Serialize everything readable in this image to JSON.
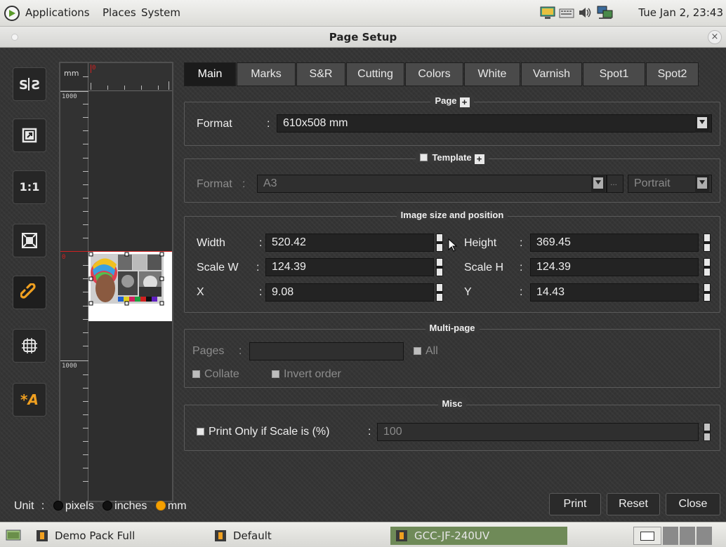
{
  "topbar": {
    "menus": [
      "Applications",
      "Places",
      "System"
    ],
    "clock": "Tue Jan  2, 23:43"
  },
  "window": {
    "title": "Page Setup",
    "close_glyph": "×"
  },
  "toolbar": [
    {
      "name": "split-view-button",
      "glyph": "S|S"
    },
    {
      "name": "fit-page-button",
      "glyph": "⧉"
    },
    {
      "name": "actual-size-button",
      "glyph": "1:1"
    },
    {
      "name": "fit-window-button",
      "glyph": "⊠"
    },
    {
      "name": "link-button",
      "glyph": "∞"
    },
    {
      "name": "center-button",
      "glyph": "⌗"
    },
    {
      "name": "auto-button",
      "glyph": "*A"
    }
  ],
  "preview": {
    "unit": "mm",
    "hruler_label": "0",
    "vruler_labels": [
      "1000",
      "0",
      "1000"
    ]
  },
  "tabs": [
    "Main",
    "Marks",
    "S&R",
    "Cutting",
    "Colors",
    "White",
    "Varnish",
    "Spot1",
    "Spot2"
  ],
  "page": {
    "title": "Page",
    "format_label": "Format",
    "colon": ":",
    "format_value": "610x508 mm"
  },
  "template": {
    "title": "Template",
    "format_label": "Format",
    "colon": ":",
    "format_value": "A3",
    "ellipsis": "...",
    "orientation": "Portrait"
  },
  "image": {
    "title": "Image size and position",
    "colon": ":",
    "width_label": "Width",
    "width_value": "520.42",
    "height_label": "Height",
    "height_value": "369.45",
    "scalew_label": "Scale W",
    "scalew_value": "124.39",
    "scaleh_label": "Scale H",
    "scaleh_value": "124.39",
    "x_label": "X",
    "x_value": "9.08",
    "y_label": "Y",
    "y_value": "14.43"
  },
  "multipage": {
    "title": "Multi-page",
    "pages_label": "Pages",
    "colon": ":",
    "pages_value": "",
    "all_label": "All",
    "collate_label": "Collate",
    "invert_label": "Invert order"
  },
  "misc": {
    "title": "Misc",
    "print_only_label": "Print Only if Scale is (%)",
    "colon": ":",
    "scale_value": "100"
  },
  "units": {
    "label": "Unit",
    "colon": ":",
    "options": [
      "pixels",
      "inches",
      "mm"
    ],
    "selected": "mm"
  },
  "buttons": {
    "print": "Print",
    "reset": "Reset",
    "close": "Close"
  },
  "taskbar": {
    "tasks": [
      "Demo Pack Full",
      "Default",
      "GCC-JF-240UV"
    ],
    "active": "GCC-JF-240UV"
  },
  "colors": {
    "accent": "#f5a000",
    "ruler_marker": "#d02020"
  }
}
